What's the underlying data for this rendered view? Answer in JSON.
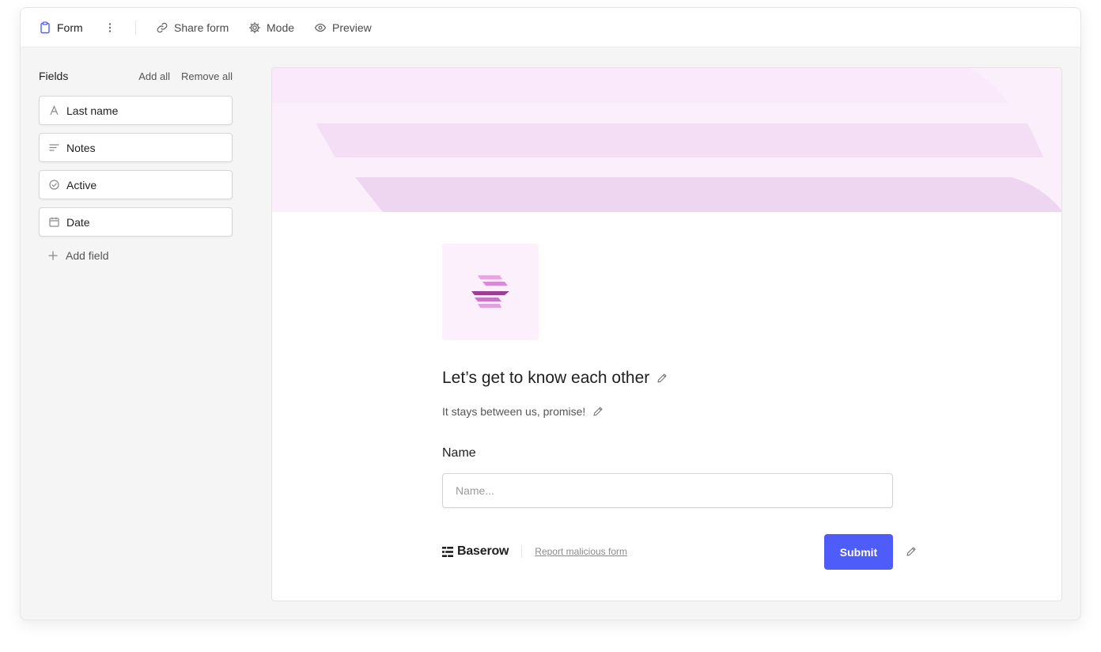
{
  "toolbar": {
    "view_name": "Form",
    "share_label": "Share form",
    "mode_label": "Mode",
    "preview_label": "Preview",
    "accent_color": "#4e5cfa"
  },
  "sidebar": {
    "title": "Fields",
    "add_all_label": "Add all",
    "remove_all_label": "Remove all",
    "fields": [
      {
        "label": "Last name",
        "icon": "text-icon"
      },
      {
        "label": "Notes",
        "icon": "long-text-icon"
      },
      {
        "label": "Active",
        "icon": "check-circle-icon"
      },
      {
        "label": "Date",
        "icon": "calendar-icon"
      }
    ],
    "add_field_label": "Add field"
  },
  "form": {
    "cover_color": "#fbeffc",
    "title": "Let’s get to know each other",
    "description": "It stays between us, promise!",
    "question_label": "Name",
    "question_placeholder": "Name...",
    "question_value": "",
    "brand_name": "Baserow",
    "report_label": "Report malicious form",
    "submit_label": "Submit"
  }
}
